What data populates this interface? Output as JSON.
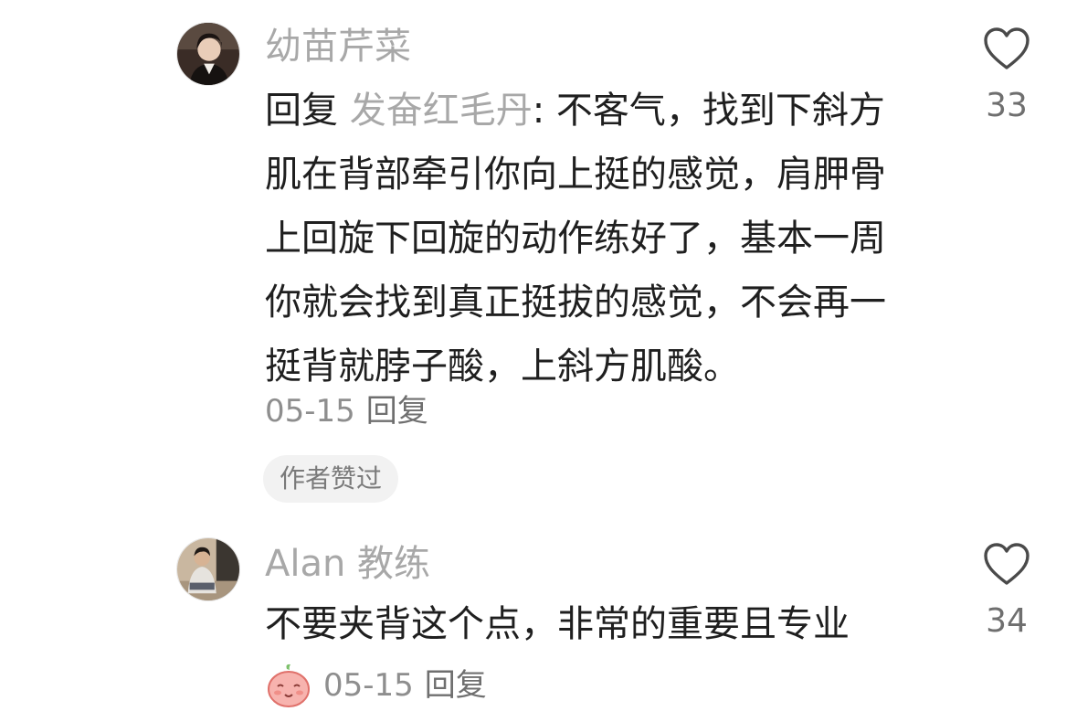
{
  "comments": [
    {
      "username": "幼苗芹菜",
      "reply_prefix": "回复 ",
      "reply_target": "发奋红毛丹",
      "reply_colon": ": ",
      "text_lines": [
        "不客气，找到下斜方",
        "肌在背部牵引你向上挺的感觉，肩胛骨",
        "上回旋下回旋的动作练好了，基本一周",
        "你就会找到真正挺拔的感觉，不会再一",
        "挺背就脖子酸，上斜方肌酸。"
      ],
      "date": "05-15",
      "reply_label": "回复",
      "badge": "作者赞过",
      "likes": "33"
    },
    {
      "username": "Alan 教练",
      "text": "不要夹背这个点，非常的重要且专业",
      "date": "05-15",
      "reply_label": "回复",
      "likes": "34"
    }
  ]
}
